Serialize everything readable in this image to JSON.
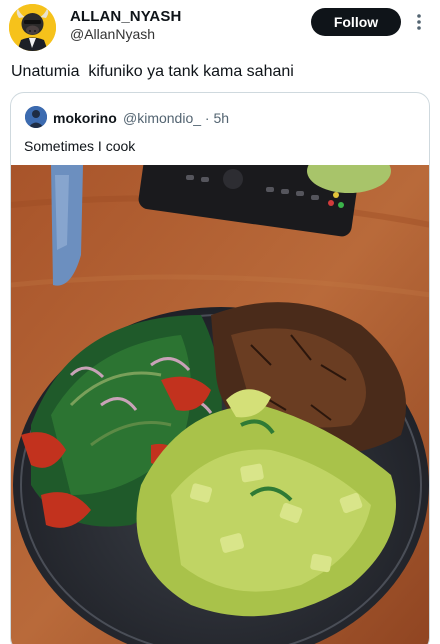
{
  "tweet": {
    "display_name": "ALLAN_NYASH",
    "handle": "@AllanNyash",
    "follow_label": "Follow",
    "text": "Unatumia  kifuniko ya tank kama sahani"
  },
  "quoted_tweet": {
    "display_name": "mokorino",
    "handle": "@kimondio_",
    "time": "· 5h",
    "text": "Sometimes I cook"
  },
  "icons": {
    "more": "more-vertical-icon",
    "avatar": "bull-avatar",
    "quoted_avatar": "user-avatar"
  },
  "colors": {
    "follow_button_bg": "#0f1419",
    "follow_button_text": "#ffffff",
    "card_border": "#cfd9de",
    "secondary_text": "#536471"
  }
}
